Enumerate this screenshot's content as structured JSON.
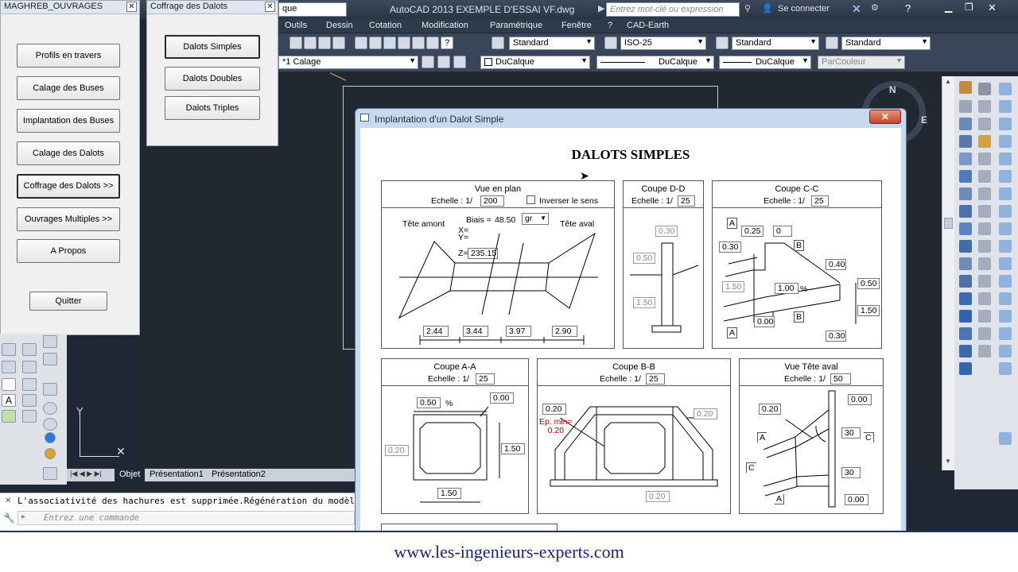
{
  "app": {
    "title": "AutoCAD 2013    EXEMPLE D'ESSAI VF.dwg",
    "search_placeholder": "Entrez mot-clé ou expression",
    "signin": "Se connecter",
    "workspace_fragment": "que"
  },
  "menu": [
    "Outils",
    "Dessin",
    "Cotation",
    "Modification",
    "Paramétrique",
    "Fenêtre",
    "?",
    "CAD-Earth"
  ],
  "toolbar": {
    "text_style": "Standard",
    "dim_style": "ISO-25",
    "table_style": "Standard",
    "multileader_style": "Standard",
    "layer": "Calage",
    "color": "DuCalque",
    "linetype": "DuCalque",
    "lineweight": "DuCalque",
    "plot_style": "ParCouleur"
  },
  "maghreb_panel": {
    "title": "MAGHREB_OUVRAGES",
    "buttons": [
      "Profils en travers",
      "Calage des Buses",
      "Implantation des Buses",
      "Calage des Dalots",
      "Coffrage des Dalots >>",
      "Ouvrages Multiples >>",
      "A Propos"
    ],
    "quit": "Quitter"
  },
  "coffrage_panel": {
    "title": "Coffrage des Dalots",
    "buttons": [
      "Dalots Simples",
      "Dalots Doubles",
      "Dalots Triples"
    ]
  },
  "dialog": {
    "title": "Implantation d'un Dalot Simple",
    "heading": "DALOTS SIMPLES",
    "vue_plan": {
      "title": "Vue en plan",
      "scale_label": "Echelle : 1/",
      "scale": "200",
      "invert": "Inverser le sens",
      "tete_amont": "Tête amont",
      "tete_aval": "Tête aval",
      "biais_label": "Biais =",
      "biais": "48.50",
      "unit": "gr",
      "x_label": "X=",
      "y_label": "Y=",
      "z_label": "Z=",
      "z": "235.15",
      "dims": [
        "2.44",
        "3.44",
        "3.97",
        "2.90"
      ]
    },
    "coupe_dd": {
      "title": "Coupe D-D",
      "scale_label": "Echelle : 1/",
      "scale": "25",
      "v1": "0.30",
      "v2": "0.50",
      "v3": "1.50"
    },
    "coupe_cc": {
      "title": "Coupe C-C",
      "scale_label": "Echelle : 1/",
      "scale": "25",
      "a_top": "A",
      "a_bottom": "A",
      "b_top": "B",
      "b_bottom": "B",
      "v025": "0.25",
      "v0": "0",
      "v030a": "0.30",
      "v040": "0.40",
      "v150a": "1.50",
      "v100": "1.00",
      "pct": "%",
      "v050": "0.50",
      "v150b": "1.50",
      "v000": "0.00",
      "v030b": "0.30"
    },
    "coupe_aa": {
      "title": "Coupe A-A",
      "scale_label": "Echelle : 1/",
      "scale": "25",
      "v050": "0.50",
      "pct": "%",
      "v000": "0.00",
      "v020": "0.20",
      "v150a": "1.50",
      "v150b": "1.50"
    },
    "coupe_bb": {
      "title": "Coupe B-B",
      "scale_label": "Echelle : 1/",
      "scale": "25",
      "v020a": "0.20",
      "ep_label": "Ep. min=",
      "ep_value": "0.20",
      "v020b": "0.20",
      "v020c": "0.20"
    },
    "tete_aval": {
      "title": "Vue Tête aval",
      "scale_label": "Echelle : 1/",
      "scale": "50",
      "v020": "0.20",
      "v000a": "0.00",
      "v30a": "30",
      "v30b": "30",
      "v000b": "0.00",
      "a1": "A",
      "a2": "A",
      "c1": "C",
      "c2": "C"
    }
  },
  "tabs": [
    "Objet",
    "Présentation1",
    "Présentation2"
  ],
  "command": {
    "history": "L'associativité des hachures est supprimée.Régénération du modèl",
    "placeholder": "Entrez une commande"
  },
  "banner": "www.les-ingenieurs-experts.com"
}
